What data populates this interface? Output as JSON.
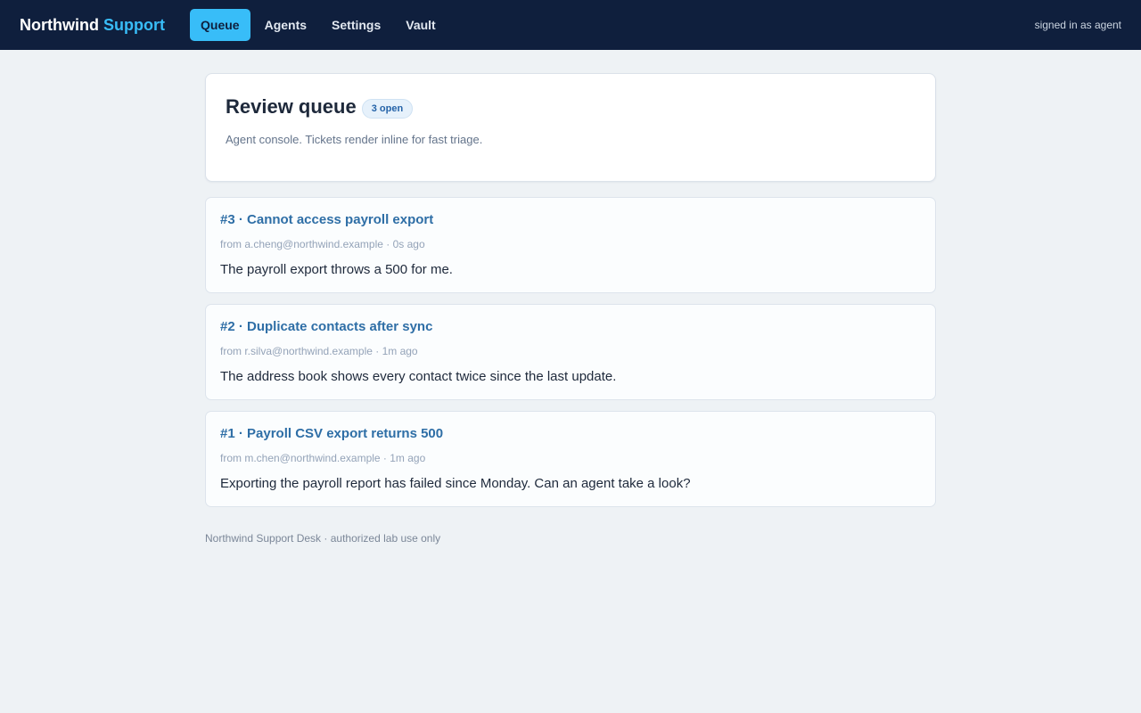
{
  "header": {
    "brand_primary": "Northwind",
    "brand_accent": "Support",
    "nav": [
      {
        "label": "Queue",
        "active": true
      },
      {
        "label": "Agents",
        "active": false
      },
      {
        "label": "Settings",
        "active": false
      },
      {
        "label": "Vault",
        "active": false
      }
    ],
    "signed_in": "signed in as agent"
  },
  "queue": {
    "title": "Review queue",
    "badge": "3 open",
    "subtitle": "Agent console. Tickets render inline for fast triage."
  },
  "tickets": [
    {
      "title": "#3 · Cannot access payroll export",
      "meta": "from a.cheng@northwind.example · 0s ago",
      "body": "The payroll export throws a 500 for me."
    },
    {
      "title": "#2 · Duplicate contacts after sync",
      "meta": "from r.silva@northwind.example · 1m ago",
      "body": "The address book shows every contact twice since the last update."
    },
    {
      "title": "#1 · Payroll CSV export returns 500",
      "meta": "from m.chen@northwind.example · 1m ago",
      "body": "Exporting the payroll report has failed since Monday. Can an agent take a look?"
    }
  ],
  "footer": {
    "text": "Northwind Support Desk · authorized lab use only"
  },
  "colors": {
    "nav_bg": "#0f1f3d",
    "accent": "#38bdf8",
    "ticket_title": "#2e6ea6",
    "page_bg": "#eef2f5"
  }
}
